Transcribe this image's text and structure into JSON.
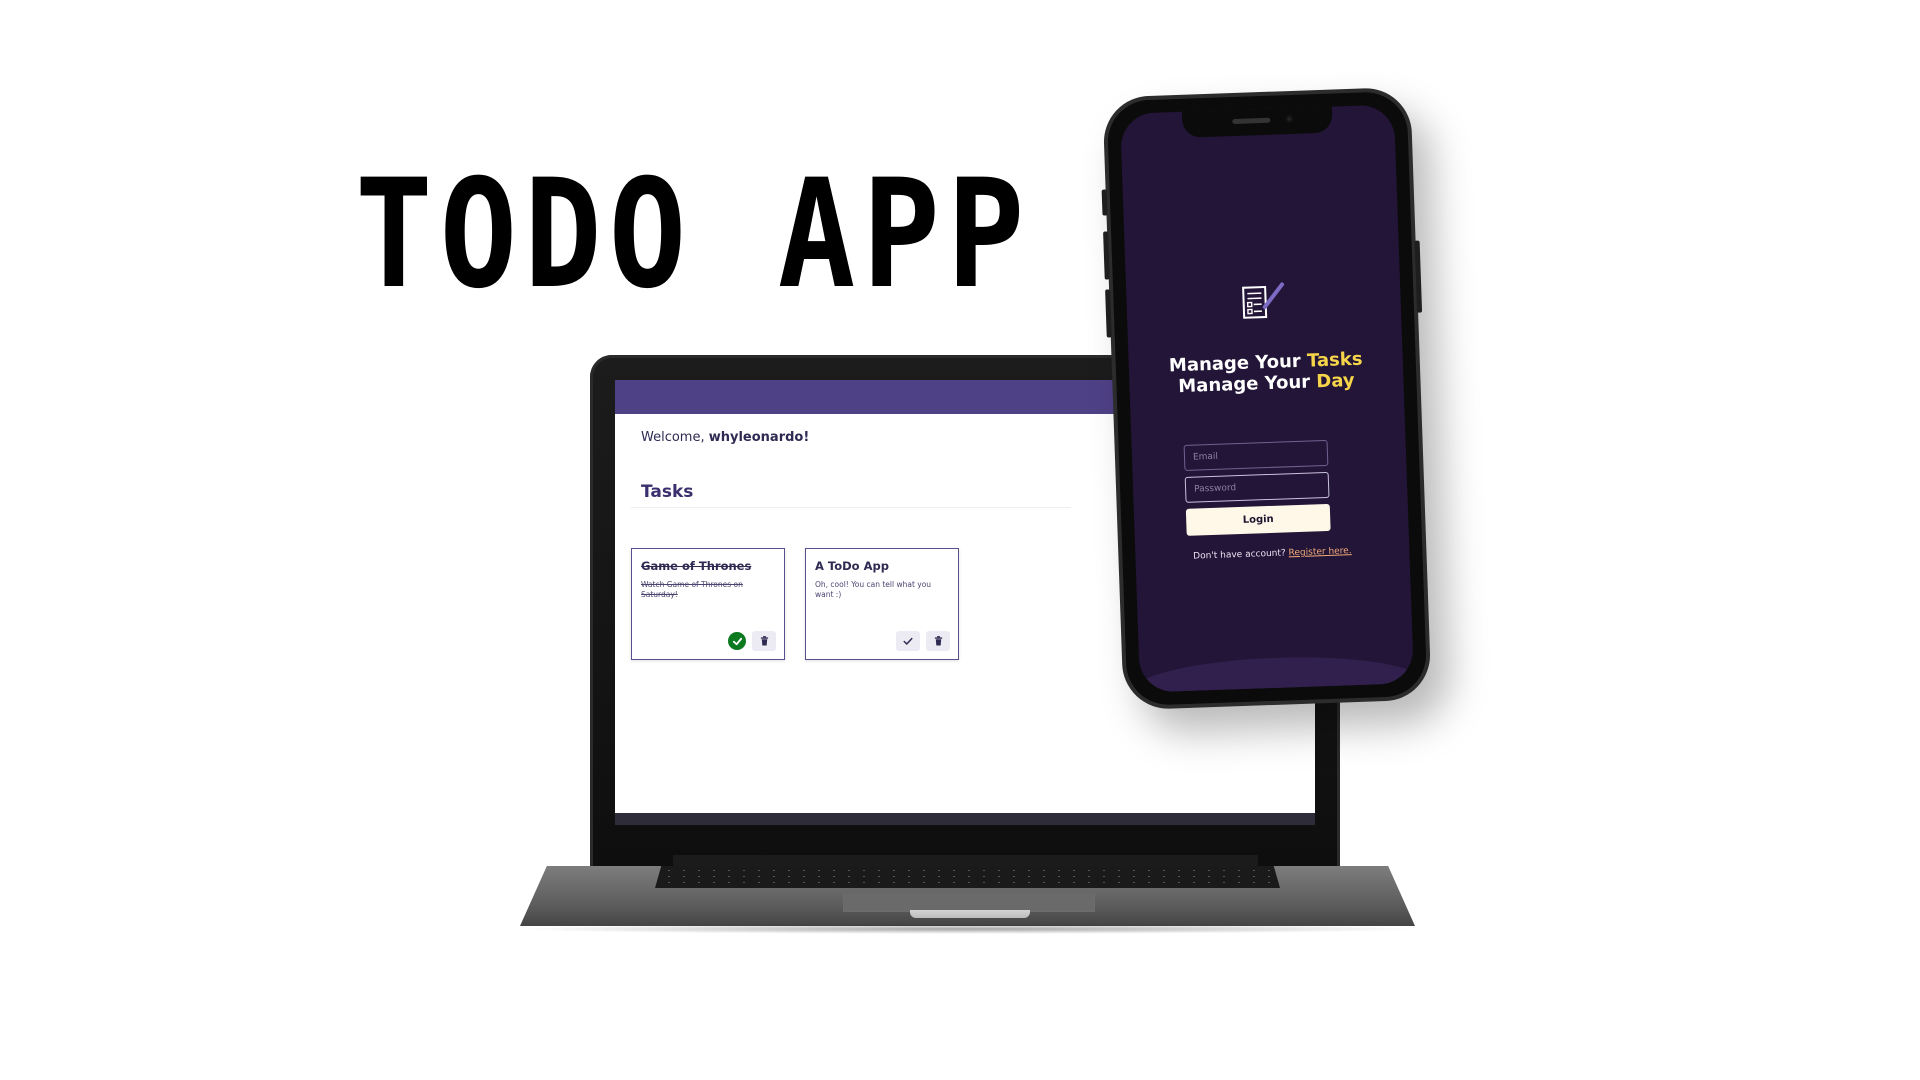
{
  "hero": {
    "title": "TODO APP"
  },
  "laptop_app": {
    "welcome_prefix": "Welcome, ",
    "username": "whyleonardo!",
    "section_title": "Tasks",
    "tasks": [
      {
        "title": "Game of Thrones",
        "description": "Watch Game of Thrones on Saturday!",
        "completed": true,
        "icons": [
          "check-circle-icon",
          "trash-icon"
        ]
      },
      {
        "title": "A ToDo App",
        "description": "Oh, cool! You can tell what you want :)",
        "completed": false,
        "icons": [
          "check-icon",
          "trash-icon"
        ]
      }
    ],
    "colors": {
      "header": "#4f4186",
      "done_green": "#0c7a1f"
    }
  },
  "phone_app": {
    "headline_line1_prefix": "Manage Your ",
    "headline_line1_accent": "Tasks",
    "headline_line2_prefix": "Manage Your ",
    "headline_line2_accent": "Day",
    "email_placeholder": "Email",
    "password_placeholder": "Password",
    "login_label": "Login",
    "register_prompt": "Don't have account? ",
    "register_link": "Register here.",
    "logo_icon": "todo-list-pencil-icon",
    "colors": {
      "background": "#231537",
      "accent": "#f7d54a",
      "link": "#f0a978"
    }
  }
}
